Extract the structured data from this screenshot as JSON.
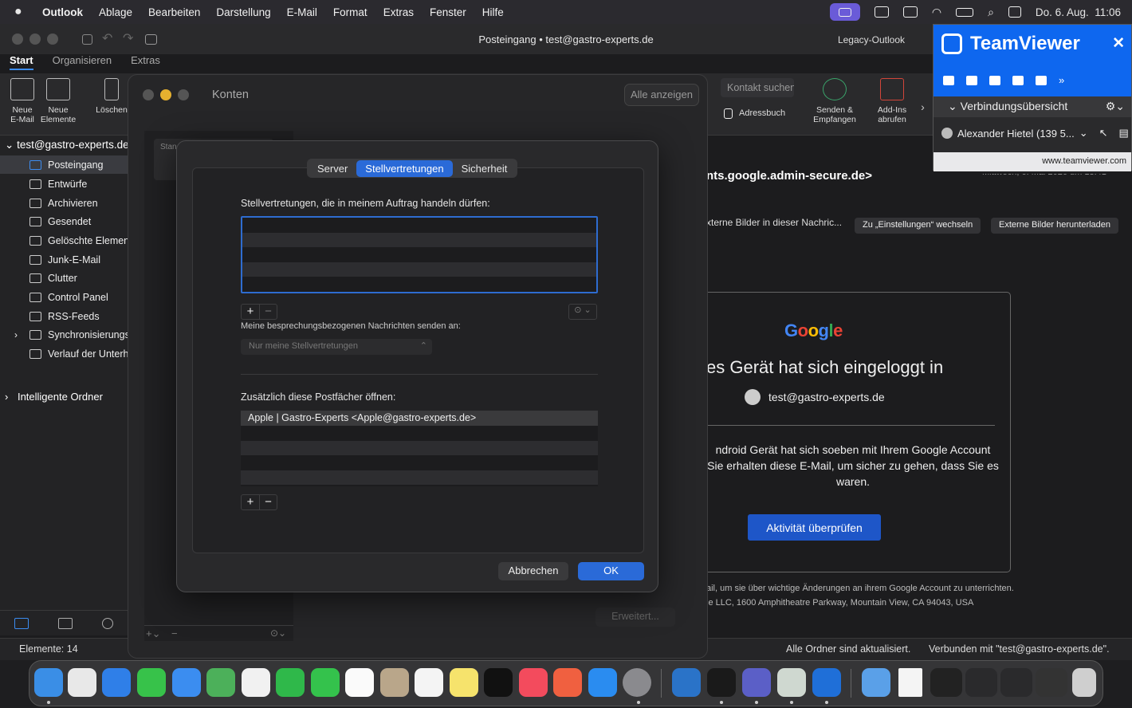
{
  "menubar": {
    "app": "Outlook",
    "items": [
      "Ablage",
      "Bearbeiten",
      "Darstellung",
      "E-Mail",
      "Format",
      "Extras",
      "Fenster",
      "Hilfe"
    ],
    "datetime": "Do. 6. Aug.  11:06"
  },
  "window": {
    "title": "Posteingang • test@gastro-experts.de",
    "legacy_label": "Legacy-Outlook"
  },
  "ribbon": {
    "tabs": [
      "Start",
      "Organisieren",
      "Extras"
    ],
    "new_mail": "Neue\nE-Mail",
    "new_items": "Neue\nElemente",
    "delete": "Löschen",
    "contact_search": "Kontakt suchen",
    "address_book": "Adressbuch",
    "send_receive": "Senden &\nEmpfangen",
    "addins": "Add-Ins\nabrufen"
  },
  "sidebar": {
    "account": "test@gastro-experts.de",
    "folders": [
      "Posteingang",
      "Entwürfe",
      "Archivieren",
      "Gesendet",
      "Gelöschte Elemente",
      "Junk-E-Mail",
      "Clutter",
      "Control Panel",
      "RSS-Feeds",
      "Synchronisierungsprobleme",
      "Verlauf der Unterhaltung"
    ],
    "smart_folders": "Intelligente Ordner"
  },
  "status": {
    "items": "Elemente: 14",
    "updated": "Alle Ordner sind aktualisiert.",
    "connected": "Verbunden mit \"test@gastro-experts.de\"."
  },
  "reading": {
    "subject": "nts.google.admin-secure.de>",
    "date": "Mittwoch, 6. Mai 2026 um 13:41",
    "external_text": "xterne Bilder in dieser Nachric...",
    "btn_settings": "Zu „Einstellungen“ wechseln",
    "btn_download": "Externe Bilder herunterladen",
    "google_logo": "Google",
    "headline": "es Gerät hat sich eingeloggt in",
    "account": "test@gastro-experts.de",
    "body": "ndroid Gerät hat sich soeben mit Ihrem Google Account\nSie erhalten diese E-Mail, um sicher zu gehen, dass Sie es\nwaren.",
    "button": "Aktivität überprüfen",
    "footer1": "ail, um sie über wichtige Änderungen an ihrem Google Account zu unterrichten.",
    "footer2": "le LLC, 1600 Amphitheatre Parkway, Mountain View, CA 94043, USA"
  },
  "konten": {
    "title": "Konten",
    "show_all": "Alle anzeigen",
    "left_label": "Stan",
    "advanced": "Erweitert..."
  },
  "sheet": {
    "tabs": [
      "Server",
      "Stellvertretungen",
      "Sicherheit"
    ],
    "delegates_label": "Stellvertretungen, die in meinem Auftrag handeln dürfen:",
    "meeting_label": "Meine besprechungsbezogenen Nachrichten senden an:",
    "meeting_value": "Nur meine Stellvertretungen",
    "mailboxes_label": "Zusätzlich diese Postfächer öffnen:",
    "mailboxes": [
      "Apple | Gastro-Experts <Apple@gastro-experts.de>"
    ],
    "cancel": "Abbrechen",
    "ok": "OK"
  },
  "teamviewer": {
    "brand": "TeamViewer",
    "overview": "Verbindungsübersicht",
    "session": "Alexander Hietel (139 5...",
    "url": "www.teamviewer.com"
  }
}
